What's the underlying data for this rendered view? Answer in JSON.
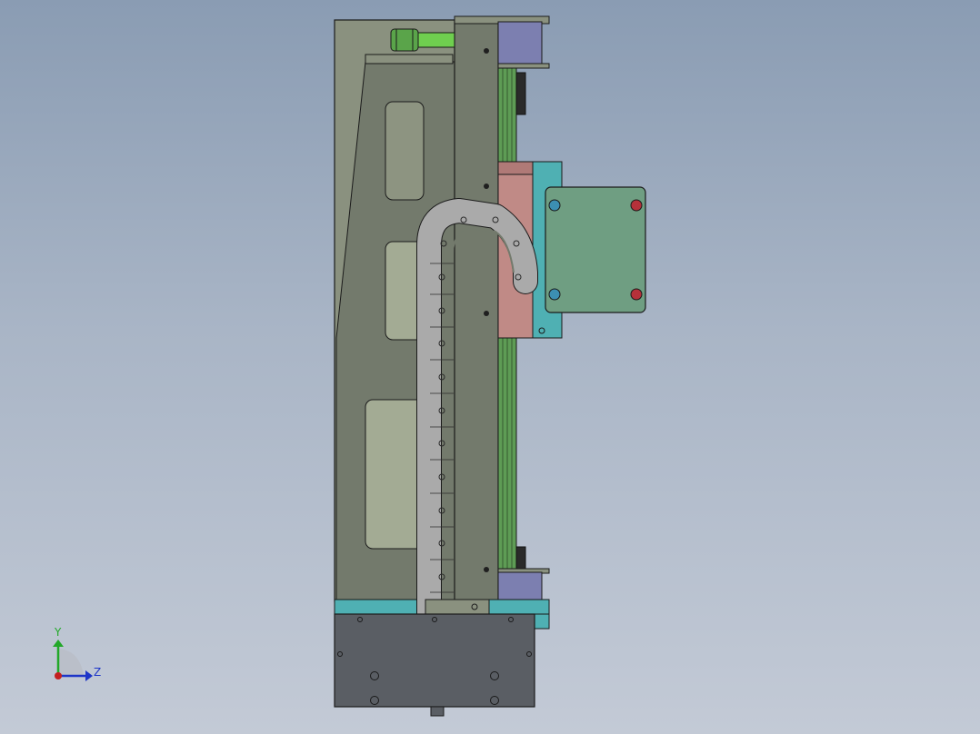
{
  "viewport": {
    "view": "cad-model-side-view",
    "background_top": "#8a9cb3",
    "background_bottom": "#c3cad6"
  },
  "model": {
    "colors": {
      "frame_plate": "#737a6c",
      "frame_plate_light": "#8a917f",
      "frame_window": "#a3ab94",
      "rail_green": "#5e9c55",
      "pulley_green": "#6fcf4f",
      "motor_plate": "#6f9e82",
      "bracket_cyan": "#4fb0b3",
      "carriage_pink": "#c08a86",
      "end_block_purple": "#7c7fb0",
      "base_dark": "#5a5e64",
      "cable_chain": "#aaaaaa",
      "bolt_red": "#b5313a",
      "bolt_blue": "#3c8fb2"
    }
  },
  "triad": {
    "y_label": "Y",
    "z_label": "Z",
    "y_color": "#22a829",
    "z_color": "#1d35c8",
    "x_color": "#c42020"
  }
}
